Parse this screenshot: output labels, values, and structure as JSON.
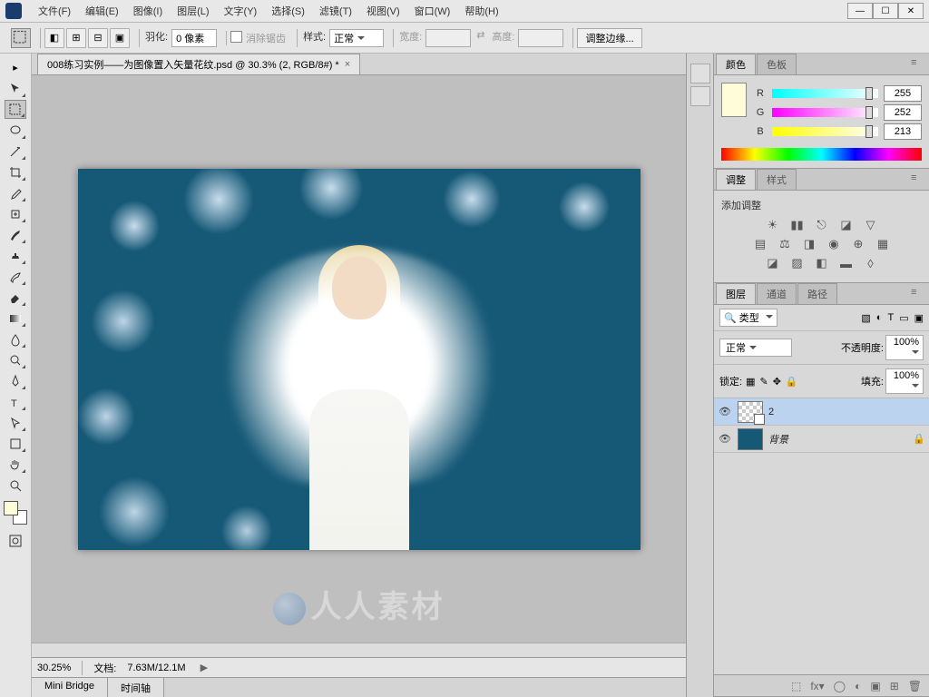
{
  "menu": {
    "items": [
      "文件(F)",
      "编辑(E)",
      "图像(I)",
      "图层(L)",
      "文字(Y)",
      "选择(S)",
      "滤镜(T)",
      "视图(V)",
      "窗口(W)",
      "帮助(H)"
    ]
  },
  "options": {
    "feather_label": "羽化:",
    "feather_value": "0 像素",
    "antialias_label": "消除锯齿",
    "style_label": "样式:",
    "style_value": "正常",
    "width_label": "宽度:",
    "height_label": "高度:",
    "refine_label": "调整边缘..."
  },
  "doc": {
    "tab_title": "008练习实例——为图像置入矢量花纹.psd @ 30.3% (2, RGB/8#) *"
  },
  "status": {
    "zoom": "30.25%",
    "doc_label": "文档:",
    "doc_size": "7.63M/12.1M"
  },
  "bottom_tabs": [
    "Mini Bridge",
    "时间轴"
  ],
  "color_panel": {
    "tabs": [
      "颜色",
      "色板"
    ],
    "channels": [
      {
        "letter": "R",
        "value": "255",
        "cls": "r"
      },
      {
        "letter": "G",
        "value": "252",
        "cls": "g"
      },
      {
        "letter": "B",
        "value": "213",
        "cls": "b"
      }
    ]
  },
  "adjust_panel": {
    "tabs": [
      "调整",
      "样式"
    ],
    "title": "添加调整"
  },
  "layers_panel": {
    "tabs": [
      "图层",
      "通道",
      "路径"
    ],
    "filter_label": "类型",
    "blend_mode": "正常",
    "opacity_label": "不透明度:",
    "opacity_value": "100%",
    "lock_label": "锁定:",
    "fill_label": "填充:",
    "fill_value": "100%",
    "layers": [
      {
        "name": "2",
        "selected": true,
        "locked": false,
        "bg": false
      },
      {
        "name": "背景",
        "selected": false,
        "locked": true,
        "bg": true
      }
    ]
  }
}
